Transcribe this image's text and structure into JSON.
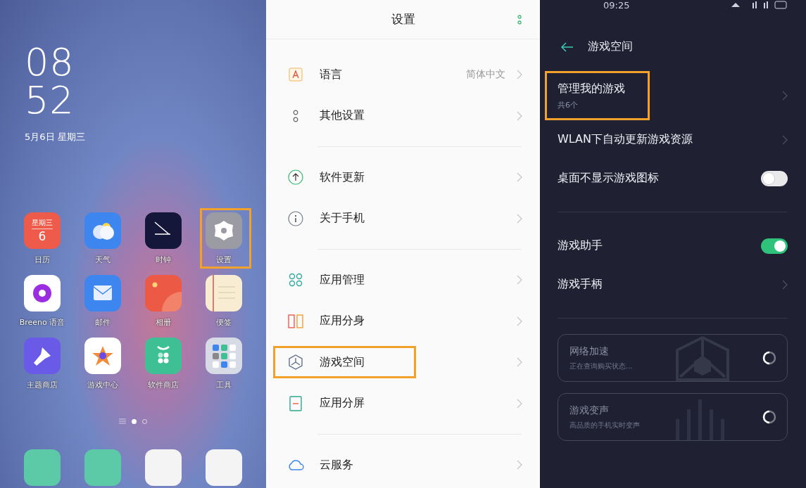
{
  "home": {
    "clock_hour": "08",
    "clock_minute": "52",
    "date": "5月6日 星期三",
    "apps": [
      {
        "label": "日历",
        "kind": "calendar",
        "color": "#ee5b4a",
        "badge_top": "星期三",
        "badge_number": "6",
        "highlighted": false
      },
      {
        "label": "天气",
        "kind": "weather",
        "color": "#3d86f0",
        "highlighted": false
      },
      {
        "label": "时钟",
        "kind": "clock",
        "color": "#14163a",
        "highlighted": false
      },
      {
        "label": "设置",
        "kind": "settings",
        "color": "#9a9ba3",
        "highlighted": true
      },
      {
        "label": "Breeno 语音",
        "kind": "voice",
        "color": "#ffffff",
        "highlighted": false
      },
      {
        "label": "邮件",
        "kind": "mail",
        "color": "#3d86f0",
        "highlighted": false
      },
      {
        "label": "相册",
        "kind": "gallery",
        "color": "#ec5a45",
        "highlighted": false
      },
      {
        "label": "便签",
        "kind": "notes",
        "color": "#f8ecd2",
        "highlighted": false
      },
      {
        "label": "主题商店",
        "kind": "themes",
        "color": "#6a5ae8",
        "highlighted": false
      },
      {
        "label": "游戏中心",
        "kind": "games",
        "color": "#ffffff",
        "highlighted": false
      },
      {
        "label": "软件商店",
        "kind": "store",
        "color": "#3fbf94",
        "highlighted": false
      },
      {
        "label": "工具",
        "kind": "folder",
        "color": "#d6dbe6",
        "highlighted": false
      }
    ],
    "pages": [
      {
        "selected": true
      },
      {
        "selected": false
      }
    ],
    "dock": [
      {
        "color": "#5cc9a7"
      },
      {
        "color": "#5cc9a7"
      },
      {
        "color": "#f4f4f4"
      },
      {
        "color": "#f4f4f4"
      }
    ]
  },
  "settings": {
    "title": "设置",
    "groups": [
      [
        {
          "label": "语言",
          "kind": "language",
          "value": "简体中文",
          "highlighted": false
        },
        {
          "label": "其他设置",
          "kind": "dots",
          "highlighted": false
        }
      ],
      [
        {
          "label": "软件更新",
          "kind": "update",
          "highlighted": false
        },
        {
          "label": "关于手机",
          "kind": "info",
          "highlighted": false
        }
      ],
      [
        {
          "label": "应用管理",
          "kind": "apps",
          "highlighted": false
        },
        {
          "label": "应用分身",
          "kind": "clone",
          "highlighted": false
        },
        {
          "label": "游戏空间",
          "kind": "game",
          "highlighted": true
        },
        {
          "label": "应用分屏",
          "kind": "split",
          "highlighted": false
        }
      ],
      [
        {
          "label": "云服务",
          "kind": "cloud",
          "highlighted": false
        }
      ]
    ]
  },
  "game_space": {
    "status_time": "09:25",
    "title": "游戏空间",
    "groups": [
      [
        {
          "kind": "link",
          "label": "管理我的游戏",
          "subtitle": "共6个",
          "highlighted": true
        },
        {
          "kind": "link",
          "label": "WLAN下自动更新游戏资源",
          "highlighted": false
        },
        {
          "kind": "toggle",
          "label": "桌面不显示游戏图标",
          "on": false,
          "highlighted": false
        }
      ],
      [
        {
          "kind": "toggle",
          "label": "游戏助手",
          "on": true,
          "highlighted": false
        },
        {
          "kind": "link",
          "label": "游戏手柄",
          "highlighted": false
        }
      ]
    ],
    "cards": [
      {
        "title": "网络加速",
        "subtitle": "正在查询购买状态...",
        "kind": "cube"
      },
      {
        "title": "游戏变声",
        "subtitle": "高品质的手机实时变声",
        "kind": "bars"
      }
    ]
  }
}
